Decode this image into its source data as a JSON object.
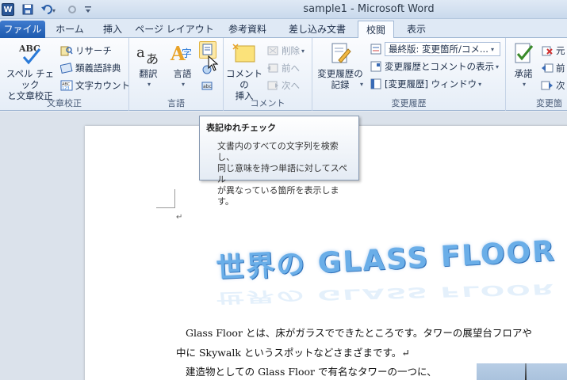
{
  "titlebar": {
    "word_icon": "W",
    "title": "sample1 - Microsoft Word",
    "qat": [
      "save-icon",
      "undo-icon",
      "redo-icon",
      "customize-icon"
    ]
  },
  "tabs": [
    "ファイル",
    "ホーム",
    "挿入",
    "ページ レイアウト",
    "参考資料",
    "差し込み文書",
    "校閲",
    "表示"
  ],
  "active_tab": "校閲",
  "ribbon": {
    "proofing": {
      "label": "文章校正",
      "spell_check_line1": "スペル チェック",
      "spell_check_line2": "と文章校正",
      "spell_icon_text": "ABC",
      "research": "リサーチ",
      "thesaurus": "類義語辞典",
      "word_count": "文字カウント"
    },
    "language": {
      "label": "言語",
      "translate": "翻訳",
      "language": "言語"
    },
    "comments": {
      "label": "コメント",
      "new_comment_line1": "コメントの",
      "new_comment_line2": "挿入",
      "delete": "削除",
      "previous": "前へ",
      "next": "次へ"
    },
    "tracking": {
      "label": "変更履歴",
      "track_changes_line1": "変更履歴の",
      "track_changes_line2": "記録",
      "display_mode": "最終版: 変更箇所/コメ...",
      "show_markup": "変更履歴とコメントの表示",
      "reviewing_pane": "[変更履歴] ウィンドウ"
    },
    "changes": {
      "label": "変更箇",
      "accept": "承諾",
      "reject": "元",
      "previous": "前",
      "next": "次"
    }
  },
  "tooltip": {
    "title": "表記ゆれチェック",
    "body_line1": "文書内のすべての文字列を検索し、",
    "body_line2": "同じ意味を持つ単語に対してスペル",
    "body_line3": "が異なっている箇所を表示します。"
  },
  "document": {
    "wordart": "世界の GLASS FLOOR",
    "line1": "Glass Floor とは、床がガラスでできたところです。タワーの展望台フロアや",
    "line2": "中に Skywalk というスポットなどさまざまです。↵",
    "line3": "建造物としての Glass Floor で有名なタワーの一つに、",
    "paragraph_mark": "↵"
  }
}
